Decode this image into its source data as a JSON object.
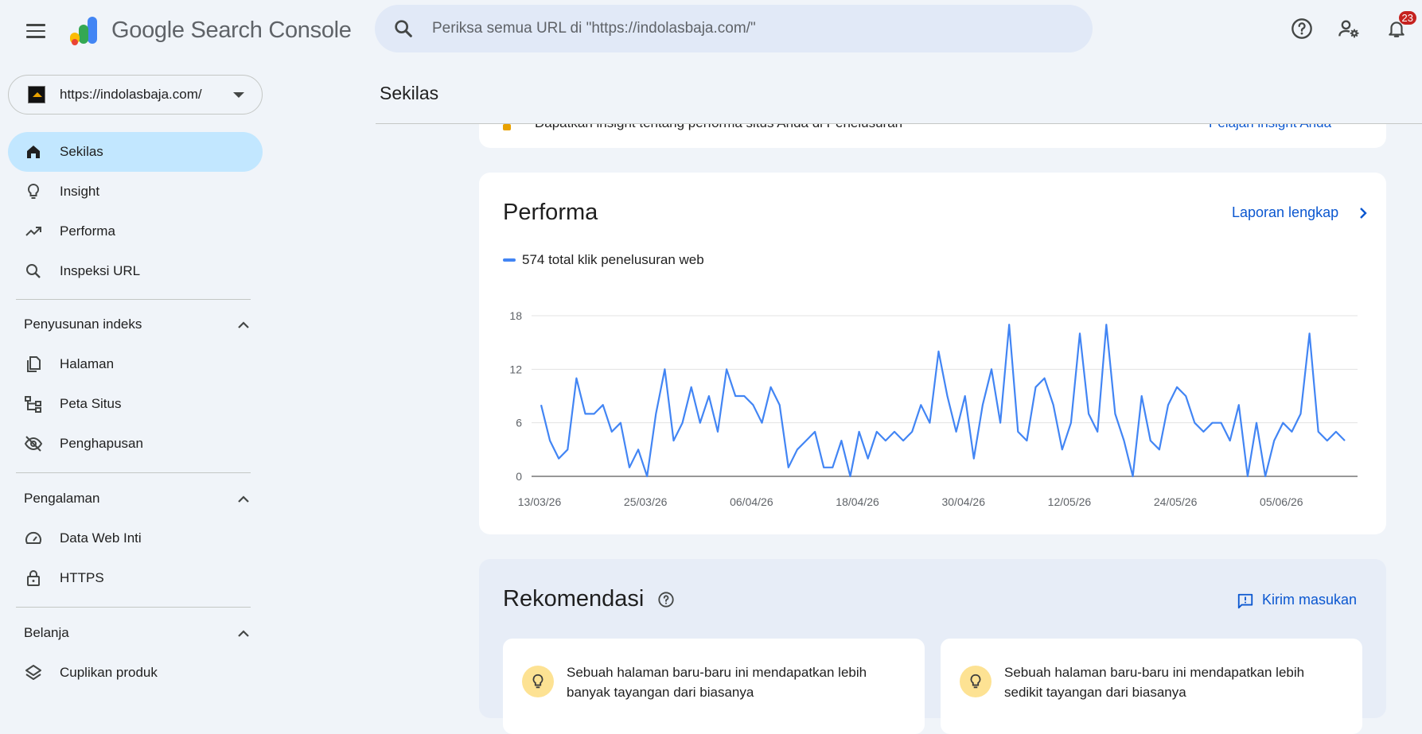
{
  "app": {
    "name": "Google Search Console",
    "name_google": "Google",
    "name_product": " Search Console"
  },
  "search": {
    "placeholder": "Periksa semua URL di \"https://indolasbaja.com/\""
  },
  "topbar": {
    "notifications_count": "23",
    "icons": [
      "help-icon",
      "manage-users-icon",
      "notifications-icon"
    ]
  },
  "property": {
    "url": "https://indolasbaja.com/"
  },
  "sidebar": {
    "items_top": [
      {
        "label": "Sekilas",
        "icon": "home-icon",
        "active": true
      },
      {
        "label": "Insight",
        "icon": "lightbulb-icon"
      },
      {
        "label": "Performa",
        "icon": "trending-up-icon"
      },
      {
        "label": "Inspeksi URL",
        "icon": "search-icon"
      }
    ],
    "section_indexing": {
      "title": "Penyusunan indeks",
      "items": [
        {
          "label": "Halaman",
          "icon": "pages-icon"
        },
        {
          "label": "Peta Situs",
          "icon": "sitemap-icon"
        },
        {
          "label": "Penghapusan",
          "icon": "visibility-off-icon"
        }
      ]
    },
    "section_experience": {
      "title": "Pengalaman",
      "items": [
        {
          "label": "Data Web Inti",
          "icon": "speed-icon"
        },
        {
          "label": "HTTPS",
          "icon": "lock-icon"
        }
      ]
    },
    "section_shopping": {
      "title": "Belanja",
      "items": [
        {
          "label": "Cuplikan produk",
          "icon": "layers-icon"
        }
      ]
    }
  },
  "main": {
    "page_title": "Sekilas",
    "insight_banner": {
      "text": "Dapatkan insight tentang performa situs Anda di Penelusuran",
      "link": "Pelajari insight Anda"
    },
    "performance": {
      "title": "Performa",
      "full_report": "Laporan lengkap",
      "legend": "574 total klik penelusuran web"
    },
    "recommendations": {
      "title": "Rekomendasi",
      "feedback": "Kirim masukan",
      "cards": [
        {
          "text": "Sebuah halaman baru-baru ini mendapatkan lebih banyak tayangan dari biasanya"
        },
        {
          "text": "Sebuah halaman baru-baru ini mendapatkan lebih sedikit tayangan dari biasanya"
        }
      ]
    }
  },
  "colors": {
    "accent": "#0b57d0",
    "active_nav": "#c2e7ff",
    "series": "#4285f4",
    "background": "#f0f4f9"
  },
  "chart_data": {
    "type": "line",
    "title": "",
    "xlabel": "",
    "ylabel": "",
    "x_tick_labels": [
      "13/03/26",
      "25/03/26",
      "06/04/26",
      "18/04/26",
      "30/04/26",
      "12/05/26",
      "24/05/26",
      "05/06/26"
    ],
    "y_ticks": [
      0,
      6,
      12,
      18
    ],
    "ylim": [
      0,
      18
    ],
    "grid": true,
    "series": [
      {
        "name": "574 total klik penelusuran web",
        "color": "#4285f4",
        "values": [
          8,
          4,
          2,
          3,
          11,
          7,
          7,
          8,
          5,
          6,
          1,
          3,
          0,
          7,
          12,
          4,
          6,
          10,
          6,
          9,
          5,
          12,
          9,
          9,
          8,
          6,
          10,
          8,
          1,
          3,
          4,
          5,
          1,
          1,
          4,
          0,
          5,
          2,
          5,
          4,
          5,
          4,
          5,
          8,
          6,
          14,
          9,
          5,
          9,
          2,
          8,
          12,
          6,
          17,
          5,
          4,
          10,
          11,
          8,
          3,
          6,
          16,
          7,
          5,
          17,
          7,
          4,
          0,
          9,
          4,
          3,
          8,
          10,
          9,
          6,
          5,
          6,
          6,
          4,
          8,
          0,
          6,
          0,
          4,
          6,
          5,
          7,
          16,
          5,
          4,
          5,
          4
        ]
      }
    ]
  }
}
